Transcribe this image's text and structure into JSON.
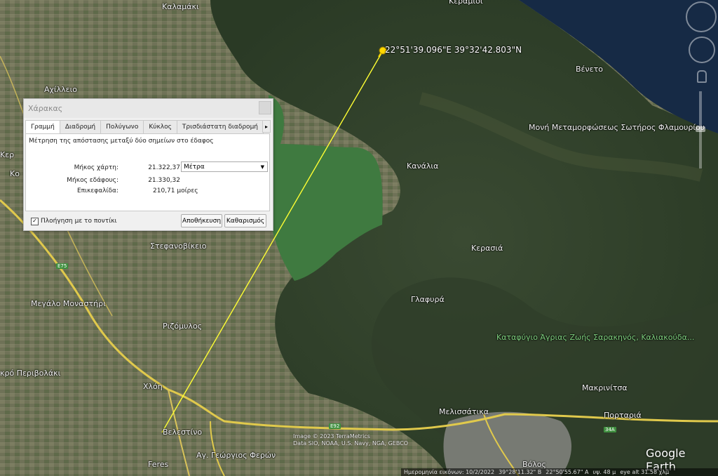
{
  "ruler": {
    "title": "Χάρακας",
    "tabs": [
      {
        "label": "Γραμμή",
        "active": true
      },
      {
        "label": "Διαδρομή",
        "active": false
      },
      {
        "label": "Πολύγωνο",
        "active": false
      },
      {
        "label": "Κύκλος",
        "active": false
      },
      {
        "label": "Τρισδιάστατη διαδρομή",
        "active": false
      }
    ],
    "tab_scroll": "▸",
    "description": "Μέτρηση της απόστασης μεταξύ δύο σημείων στο έδαφος",
    "map_length_label": "Μήκος χάρτη:",
    "map_length_value": "21.322,37",
    "unit_selected": "Μέτρα",
    "ground_length_label": "Μήκος εδάφους:",
    "ground_length_value": "21.330,32",
    "heading_label": "Επικεφαλίδα:",
    "heading_value": "210,71 μοίρες",
    "mouse_nav_label": "Πλοήγηση με το ποντίκι",
    "mouse_nav_checked": "✓",
    "save_label": "Αποθήκευση",
    "clear_label": "Καθαρισμός"
  },
  "map": {
    "pin_coordinates": "22°51'39.096\"E 39°32'42.803\"N",
    "places": {
      "kalamaki": "Καλαμάκι",
      "keramidi": "Κεράμιδι",
      "acheilleio": "Αχίλλειο",
      "veneto": "Βένετο",
      "moni": "Μονή Μεταμορφώσεως Σωτήρος Φλαμουρίου",
      "kanalia": "Κανάλια",
      "kerasia": "Κερασιά",
      "stefanovikeio": "Στεφανοβίκειο",
      "megalo_monastiri": "Μεγάλο Μοναστήρι",
      "glafyra": "Γλαφυρά",
      "rizomylos": "Ριζόμυλος",
      "katafygio": "Καταφύγιο Άγριας Ζωής Σαρακηνός, Καλιακούδα...",
      "perivolaki": "κρό Περιβολάκι",
      "chloi": "Χλόη",
      "makrinitsa": "Μακρινίτσα",
      "melissatika": "Μελισσάτικα",
      "portaria": "Πορταριά",
      "velestino": "Βελεστίνο",
      "feres": "Feres",
      "ag_georgios": "Αγ. Γεώργιος Φερών",
      "volos": "Βόλος",
      "ker": "Κερ",
      "ko": "Κο"
    },
    "roads": {
      "e75": "E75",
      "e92": "E92",
      "r34a": "34A"
    },
    "copyright": "Image © 2023 TerraMetrics\nData SIO, NOAA, U.S. Navy, NGA, GEBCO",
    "logo": "Google Earth"
  },
  "status": {
    "imagery_date": "Ημερομηνία εικόνων: 10/2/2022",
    "lat": "39°28'11.32\" Β",
    "lon": "22°50'55.67\" Α",
    "elevation": "υψ. 48 μ",
    "eye_alt": "eye alt 31.58 χλμ"
  }
}
